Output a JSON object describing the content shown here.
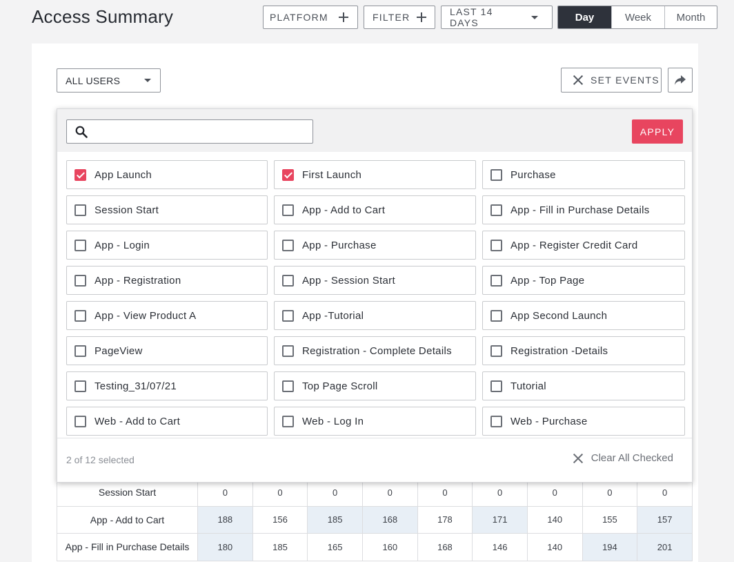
{
  "header": {
    "title": "Access Summary",
    "platform_label": "PLATFORM",
    "filter_label": "FILTER",
    "date_range_label": "LAST 14 DAYS",
    "granularity": [
      {
        "label": "Day",
        "active": true
      },
      {
        "label": "Week",
        "active": false
      },
      {
        "label": "Month",
        "active": false
      }
    ]
  },
  "toolbar": {
    "user_segment": "ALL USERS",
    "set_events_label": "SET EVENTS"
  },
  "event_picker": {
    "search_placeholder": "",
    "apply_label": "APPLY",
    "events": [
      {
        "label": "App Launch",
        "checked": true
      },
      {
        "label": "First Launch",
        "checked": true
      },
      {
        "label": "Purchase",
        "checked": false
      },
      {
        "label": "Session Start",
        "checked": false
      },
      {
        "label": "App - Add to Cart",
        "checked": false
      },
      {
        "label": "App - Fill in Purchase Details",
        "checked": false
      },
      {
        "label": "App - Login",
        "checked": false
      },
      {
        "label": "App - Purchase",
        "checked": false
      },
      {
        "label": "App - Register Credit Card",
        "checked": false
      },
      {
        "label": "App - Registration",
        "checked": false
      },
      {
        "label": "App - Session Start",
        "checked": false
      },
      {
        "label": "App - Top Page",
        "checked": false
      },
      {
        "label": "App - View Product A",
        "checked": false
      },
      {
        "label": "App -Tutorial",
        "checked": false
      },
      {
        "label": "App Second Launch",
        "checked": false
      },
      {
        "label": "PageView",
        "checked": false
      },
      {
        "label": "Registration - Complete Details",
        "checked": false
      },
      {
        "label": "Registration -Details",
        "checked": false
      },
      {
        "label": "Testing_31/07/21",
        "checked": false
      },
      {
        "label": "Top Page Scroll",
        "checked": false
      },
      {
        "label": "Tutorial",
        "checked": false
      },
      {
        "label": "Web - Add to Cart",
        "checked": false
      },
      {
        "label": "Web - Log In",
        "checked": false
      },
      {
        "label": "Web - Purchase",
        "checked": false
      }
    ],
    "selected_count_text": "2 of 12 selected",
    "clear_label": "Clear All Checked"
  },
  "table": {
    "rows": [
      {
        "label": "Session Start",
        "values": [
          "0",
          "0",
          "0",
          "0",
          "0",
          "0",
          "0",
          "0",
          "0"
        ],
        "highlight": [
          false,
          false,
          false,
          false,
          false,
          false,
          false,
          false,
          false
        ]
      },
      {
        "label": "App - Add to Cart",
        "values": [
          "188",
          "156",
          "185",
          "168",
          "178",
          "171",
          "140",
          "155",
          "157"
        ],
        "highlight": [
          true,
          false,
          true,
          true,
          false,
          true,
          false,
          false,
          true
        ]
      },
      {
        "label": "App - Fill in Purchase Details",
        "values": [
          "180",
          "185",
          "165",
          "160",
          "168",
          "146",
          "140",
          "194",
          "201"
        ],
        "highlight": [
          true,
          false,
          false,
          false,
          false,
          false,
          false,
          true,
          true
        ]
      }
    ]
  },
  "colors": {
    "accent": "#e8455f",
    "active_segment": "#2e323b",
    "highlight_cell": "#e8eff6"
  }
}
